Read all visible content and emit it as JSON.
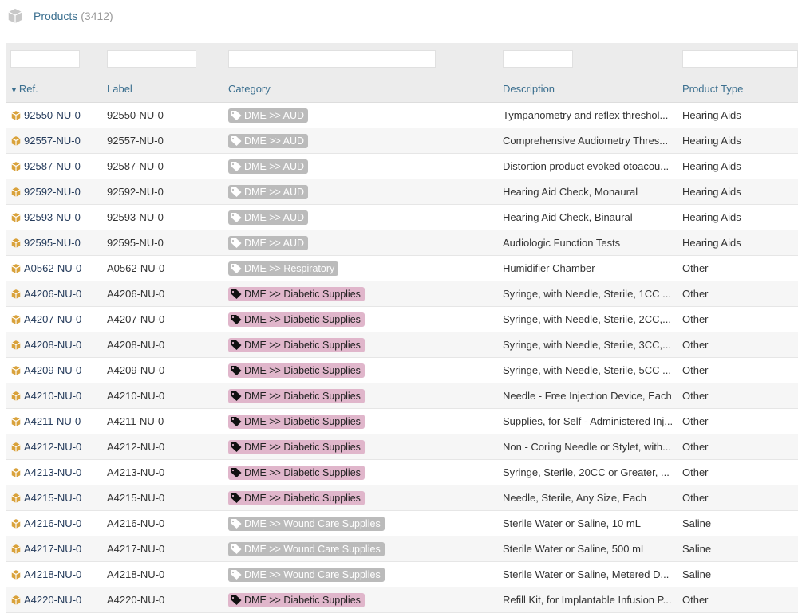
{
  "header": {
    "title": "Products",
    "count": "(3412)"
  },
  "columns": [
    {
      "label": "Ref.",
      "sorted": true
    },
    {
      "label": "Label"
    },
    {
      "label": "Category"
    },
    {
      "label": "Description"
    },
    {
      "label": "Product Type"
    }
  ],
  "colors": {
    "tag_grey": "#bbbbbb",
    "tag_pink": "#e0b6cb",
    "link": "#263c5c",
    "accent": "#3b6f8f",
    "product_icon": "#d9a23b"
  },
  "rows": [
    {
      "ref": "92550-NU-0",
      "label": "92550-NU-0",
      "category": "DME >> AUD",
      "tag_style": "grey",
      "description": "Tympanometry and reflex threshol...",
      "type": "Hearing Aids"
    },
    {
      "ref": "92557-NU-0",
      "label": "92557-NU-0",
      "category": "DME >> AUD",
      "tag_style": "grey",
      "description": "Comprehensive Audiometry Thres...",
      "type": "Hearing Aids"
    },
    {
      "ref": "92587-NU-0",
      "label": "92587-NU-0",
      "category": "DME >> AUD",
      "tag_style": "grey",
      "description": "Distortion product evoked otoacou...",
      "type": "Hearing Aids"
    },
    {
      "ref": "92592-NU-0",
      "label": "92592-NU-0",
      "category": "DME >> AUD",
      "tag_style": "grey",
      "description": "Hearing Aid Check, Monaural",
      "type": "Hearing Aids"
    },
    {
      "ref": "92593-NU-0",
      "label": "92593-NU-0",
      "category": "DME >> AUD",
      "tag_style": "grey",
      "description": "Hearing Aid Check, Binaural",
      "type": "Hearing Aids"
    },
    {
      "ref": "92595-NU-0",
      "label": "92595-NU-0",
      "category": "DME >> AUD",
      "tag_style": "grey",
      "description": "Audiologic Function Tests",
      "type": "Hearing Aids"
    },
    {
      "ref": "A0562-NU-0",
      "label": "A0562-NU-0",
      "category": "DME >> Respiratory",
      "tag_style": "grey",
      "description": "Humidifier Chamber",
      "type": "Other"
    },
    {
      "ref": "A4206-NU-0",
      "label": "A4206-NU-0",
      "category": "DME >> Diabetic Supplies",
      "tag_style": "pink",
      "description": "Syringe, with Needle, Sterile, 1CC ...",
      "type": "Other"
    },
    {
      "ref": "A4207-NU-0",
      "label": "A4207-NU-0",
      "category": "DME >> Diabetic Supplies",
      "tag_style": "pink",
      "description": "Syringe, with Needle, Sterile, 2CC,...",
      "type": "Other"
    },
    {
      "ref": "A4208-NU-0",
      "label": "A4208-NU-0",
      "category": "DME >> Diabetic Supplies",
      "tag_style": "pink",
      "description": "Syringe, with Needle, Sterile, 3CC,...",
      "type": "Other"
    },
    {
      "ref": "A4209-NU-0",
      "label": "A4209-NU-0",
      "category": "DME >> Diabetic Supplies",
      "tag_style": "pink",
      "description": "Syringe, with Needle, Sterile, 5CC ...",
      "type": "Other"
    },
    {
      "ref": "A4210-NU-0",
      "label": "A4210-NU-0",
      "category": "DME >> Diabetic Supplies",
      "tag_style": "pink",
      "description": "Needle - Free Injection Device, Each",
      "type": "Other"
    },
    {
      "ref": "A4211-NU-0",
      "label": "A4211-NU-0",
      "category": "DME >> Diabetic Supplies",
      "tag_style": "pink",
      "description": "Supplies, for Self - Administered Inj...",
      "type": "Other"
    },
    {
      "ref": "A4212-NU-0",
      "label": "A4212-NU-0",
      "category": "DME >> Diabetic Supplies",
      "tag_style": "pink",
      "description": "Non - Coring Needle or Stylet, with...",
      "type": "Other"
    },
    {
      "ref": "A4213-NU-0",
      "label": "A4213-NU-0",
      "category": "DME >> Diabetic Supplies",
      "tag_style": "pink",
      "description": "Syringe, Sterile, 20CC or Greater, ...",
      "type": "Other"
    },
    {
      "ref": "A4215-NU-0",
      "label": "A4215-NU-0",
      "category": "DME >> Diabetic Supplies",
      "tag_style": "pink",
      "description": "Needle, Sterile, Any Size, Each",
      "type": "Other"
    },
    {
      "ref": "A4216-NU-0",
      "label": "A4216-NU-0",
      "category": "DME >> Wound Care Supplies",
      "tag_style": "grey",
      "description": "Sterile Water or Saline, 10 mL",
      "type": "Saline"
    },
    {
      "ref": "A4217-NU-0",
      "label": "A4217-NU-0",
      "category": "DME >> Wound Care Supplies",
      "tag_style": "grey",
      "description": "Sterile Water or Saline, 500 mL",
      "type": "Saline"
    },
    {
      "ref": "A4218-NU-0",
      "label": "A4218-NU-0",
      "category": "DME >> Wound Care Supplies",
      "tag_style": "grey",
      "description": "Sterile Water or Saline, Metered D...",
      "type": "Saline"
    },
    {
      "ref": "A4220-NU-0",
      "label": "A4220-NU-0",
      "category": "DME >> Diabetic Supplies",
      "tag_style": "pink",
      "description": "Refill Kit, for Implantable Infusion P...",
      "type": "Other"
    }
  ]
}
